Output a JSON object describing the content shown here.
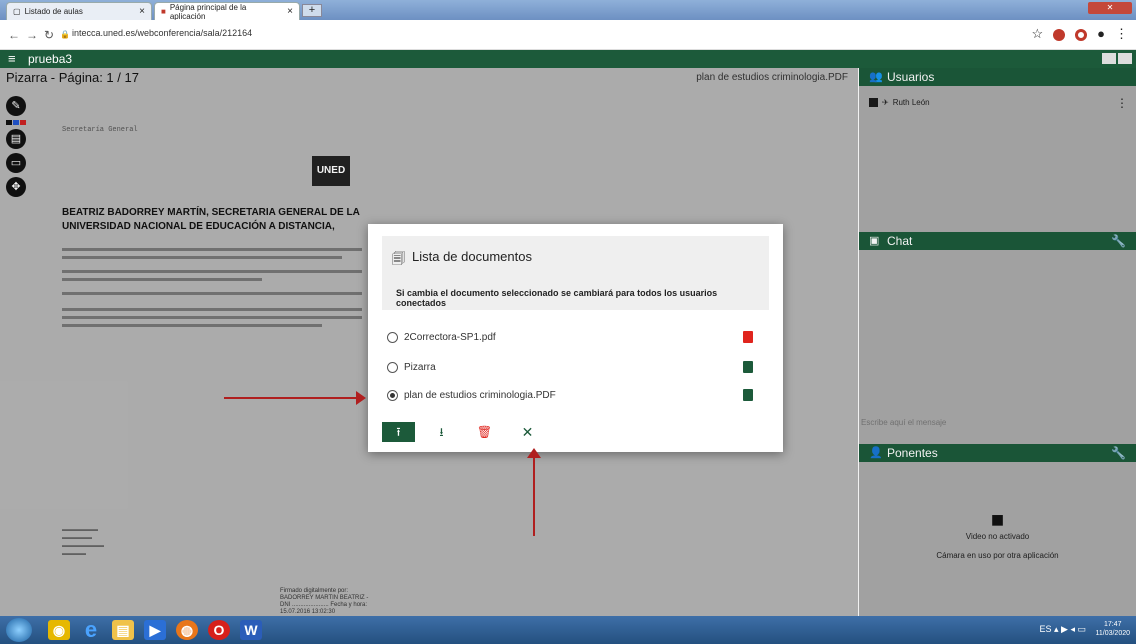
{
  "browser": {
    "tabs": [
      {
        "label": "Listado de aulas"
      },
      {
        "label": "Página principal de la aplicación"
      }
    ],
    "url": "intecca.uned.es/webconferencia/sala/212164"
  },
  "app": {
    "title": "prueba3"
  },
  "whiteboard": {
    "title": "Pizarra - Página: 1 / 17",
    "current_doc": "plan de estudios criminologia.PDF",
    "page_header": "Secretaría General",
    "logo_text": "UNED",
    "heading": "BEATRIZ BADORREY MARTÍN, SECRETARIA GENERAL DE LA UNIVERSIDAD NACIONAL DE EDUCACIÓN A DISTANCIA,",
    "signature_text": "Firmado digitalmente por: BADORREY MARTIN BEATRIZ - DNI ...................... Fecha y hora: 15.07.2016 13:02:30"
  },
  "side": {
    "users_title": "Usuarios",
    "user_name": "Ruth León",
    "chat_title": "Chat",
    "chat_placeholder": "Escribe aquí el mensaje",
    "speakers_title": "Ponentes",
    "video_off": "Video no activado",
    "camera_busy": "Cámara en uso por otra aplicación"
  },
  "modal": {
    "title": "Lista de documentos",
    "warning": "Si cambia el documento seleccionado se cambiará para todos los usuarios conectados",
    "items": [
      {
        "name": "2Correctora-SP1.pdf",
        "selected": false,
        "icon_color": "#e0241d"
      },
      {
        "name": "Pizarra",
        "selected": false,
        "icon_color": "#1c5a3a"
      },
      {
        "name": "plan de estudios criminologia.PDF",
        "selected": true,
        "icon_color": "#1c5a3a"
      }
    ]
  },
  "taskbar": {
    "time": "17:47",
    "date": "11/03/2020",
    "lang": "ES"
  },
  "colors": {
    "accent": "#1c5a3a",
    "danger": "#e0241d",
    "annotation": "#b01f1f"
  }
}
